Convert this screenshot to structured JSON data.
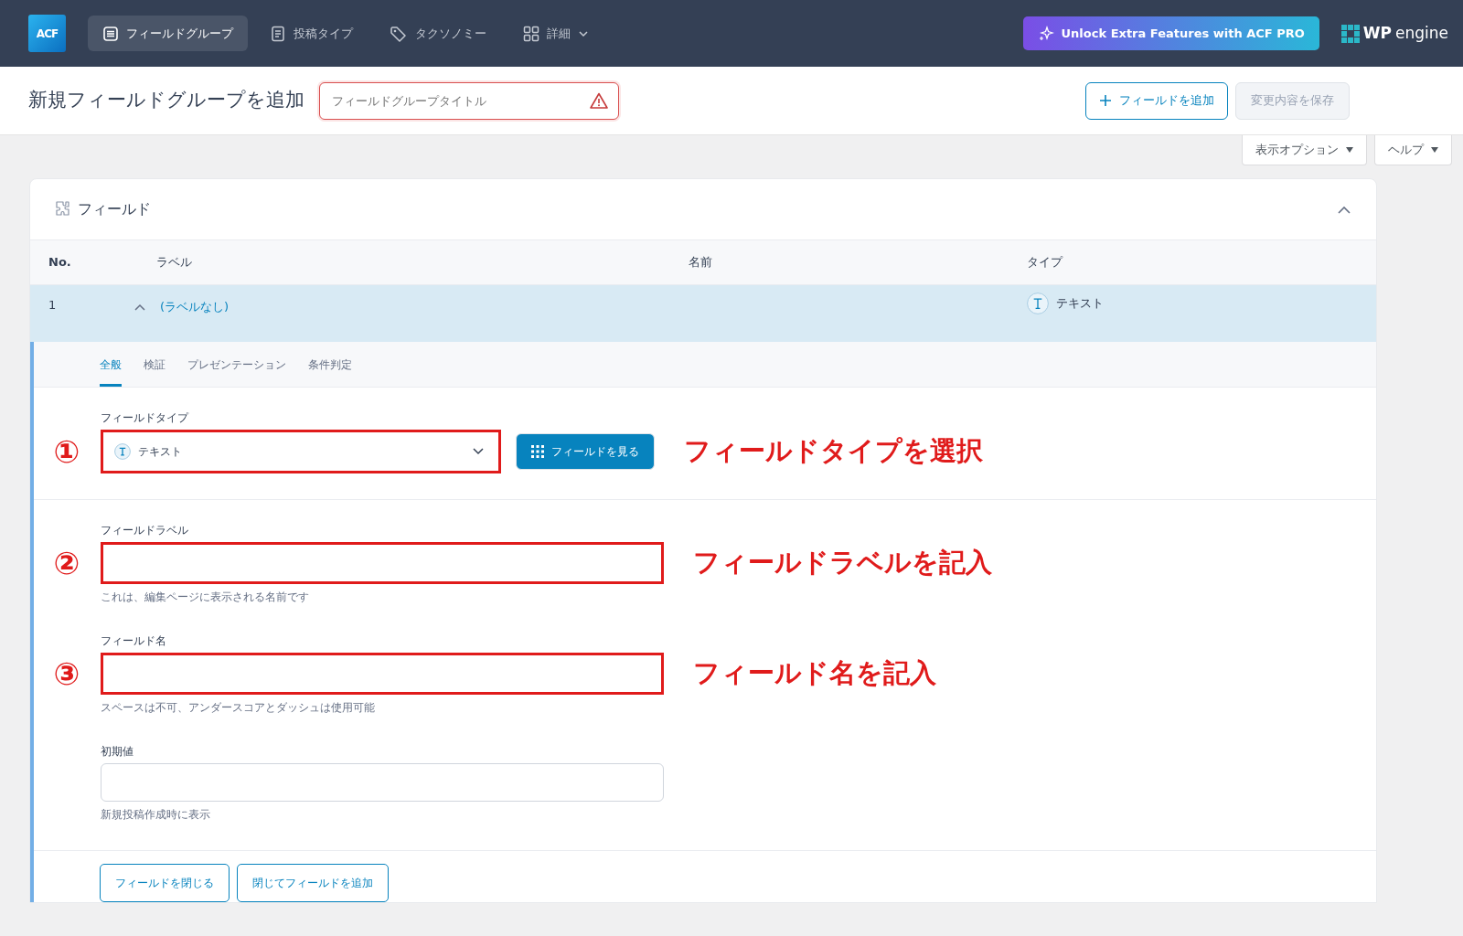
{
  "topbar": {
    "logo": "ACF",
    "nav": [
      {
        "label": "フィールドグループ",
        "kind": "list",
        "selected": true
      },
      {
        "label": "投稿タイプ",
        "kind": "page",
        "selected": false
      },
      {
        "label": "タクソノミー",
        "kind": "tag",
        "selected": false
      },
      {
        "label": "詳細",
        "kind": "grid",
        "selected": false,
        "dropdown": true
      }
    ],
    "pro_button": "Unlock Extra Features with ACF PRO",
    "brand_mark": "WP",
    "brand_text": "engine"
  },
  "header": {
    "title": "新規フィールドグループを追加",
    "title_field": {
      "placeholder": "フィールドグループタイトル",
      "invalid": true
    },
    "add_button": "フィールドを追加",
    "save_button": {
      "label": "変更内容を保存",
      "disabled": true
    }
  },
  "screen_tabs": [
    "表示オプション",
    "ヘルプ"
  ],
  "fields_panel": {
    "title": "フィールド",
    "expanded": true,
    "columns": [
      "No.",
      "ラベル",
      "名前",
      "タイプ"
    ],
    "rows": [
      {
        "no": "1",
        "label": "(ラベルなし)",
        "type": "テキスト",
        "expanded": true,
        "selected": true
      }
    ],
    "settings_tabs": [
      {
        "label": "全般",
        "selected": true
      },
      {
        "label": "検証",
        "selected": false
      },
      {
        "label": "プレゼンテーション",
        "selected": false
      },
      {
        "label": "条件判定",
        "selected": false
      }
    ],
    "settings": [
      {
        "kind": "select",
        "label": "フィールドタイプ",
        "value": "テキスト",
        "button": "フィールドを見る",
        "highlighted": true,
        "marker": "①",
        "callout": "フィールドタイプを選択"
      },
      {
        "kind": "text",
        "label": "フィールドラベル",
        "instructions": "これは、編集ページに表示される名前です",
        "highlighted": true,
        "marker": "②",
        "callout": "フィールドラベルを記入"
      },
      {
        "kind": "text",
        "label": "フィールド名",
        "instructions": "スペースは不可、アンダースコアとダッシュは使用可能",
        "highlighted": true,
        "marker": "③",
        "callout": "フィールド名を記入"
      },
      {
        "kind": "text",
        "label": "初期値",
        "instructions": "新規投稿作成時に表示",
        "highlighted": false
      }
    ],
    "footer_buttons": [
      "フィールドを閉じる",
      "閉じてフィールドを追加"
    ]
  }
}
